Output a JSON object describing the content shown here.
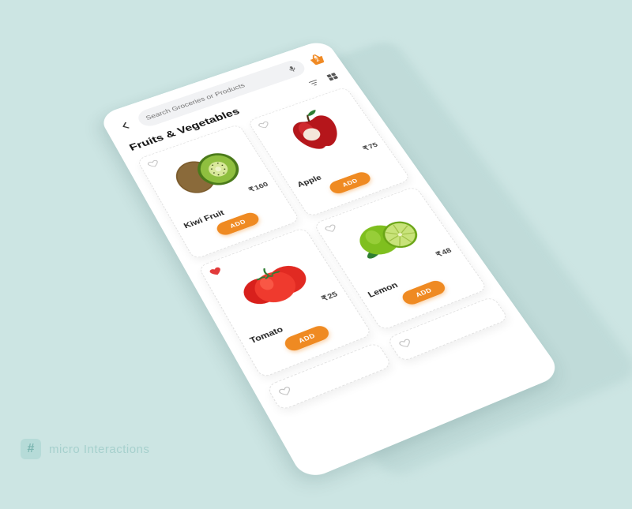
{
  "header": {
    "search_placeholder": "Search Groceries or Products",
    "basket_count": "2"
  },
  "category": {
    "title": "Fruits & Vegetables"
  },
  "labels": {
    "currency": "₹",
    "add": "ADD"
  },
  "products": [
    {
      "name": "Kiwi Fruit",
      "price": "160",
      "favorite": false
    },
    {
      "name": "Apple",
      "price": "75",
      "favorite": false
    },
    {
      "name": "Tomato",
      "price": "25",
      "favorite": true
    },
    {
      "name": "Lemon",
      "price": "48",
      "favorite": false
    }
  ],
  "footer": {
    "hash": "#",
    "text": "micro Interactions"
  },
  "colors": {
    "accent": "#ef8a22",
    "bg": "#cce5e3"
  }
}
